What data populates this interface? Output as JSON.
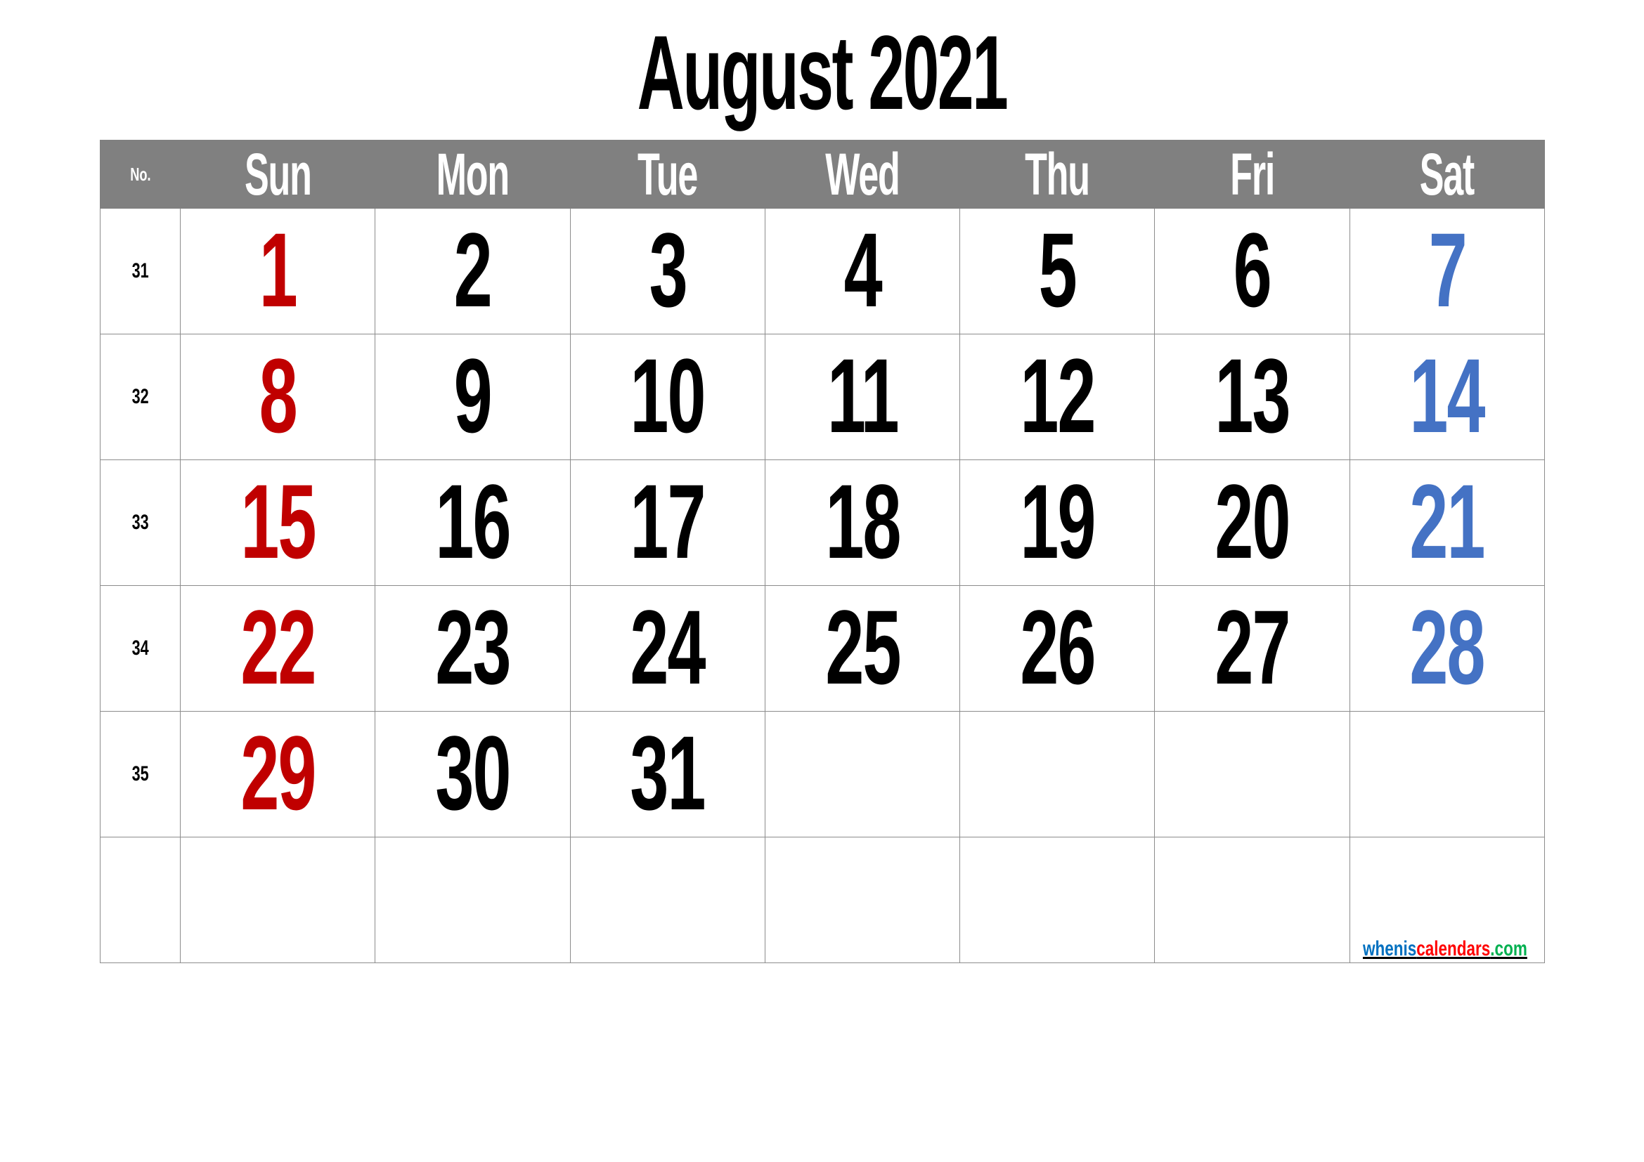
{
  "title": "August 2021",
  "header": {
    "week_no_label": "No.",
    "days": [
      "Sun",
      "Mon",
      "Tue",
      "Wed",
      "Thu",
      "Fri",
      "Sat"
    ]
  },
  "colors": {
    "sunday": "#C00000",
    "weekday": "#000000",
    "saturday": "#4472C4",
    "header_bg": "#808080"
  },
  "weeks": [
    {
      "no": "31",
      "days": [
        "1",
        "2",
        "3",
        "4",
        "5",
        "6",
        "7"
      ]
    },
    {
      "no": "32",
      "days": [
        "8",
        "9",
        "10",
        "11",
        "12",
        "13",
        "14"
      ]
    },
    {
      "no": "33",
      "days": [
        "15",
        "16",
        "17",
        "18",
        "19",
        "20",
        "21"
      ]
    },
    {
      "no": "34",
      "days": [
        "22",
        "23",
        "24",
        "25",
        "26",
        "27",
        "28"
      ]
    },
    {
      "no": "35",
      "days": [
        "29",
        "30",
        "31",
        "",
        "",
        "",
        ""
      ]
    },
    {
      "no": "",
      "days": [
        "",
        "",
        "",
        "",
        "",
        "",
        ""
      ]
    }
  ],
  "watermark": {
    "part1": "whenis",
    "part2": "calendars",
    "part3": ".com"
  }
}
